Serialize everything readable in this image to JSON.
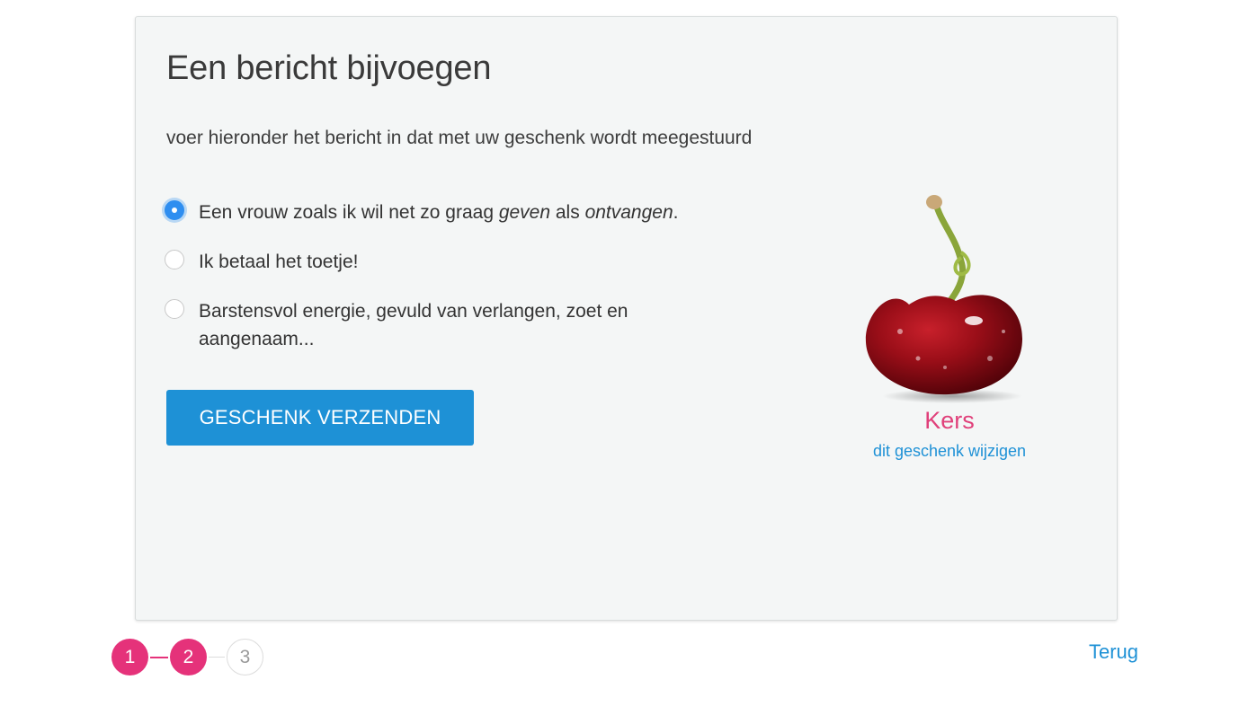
{
  "card": {
    "title": "Een bericht bijvoegen",
    "subtitle": "voer hieronder het bericht in dat met uw geschenk wordt meegestuurd"
  },
  "options": [
    {
      "selected": true,
      "parts": [
        "Een vrouw zoals ik wil net zo graag ",
        "geven",
        " als ",
        "ontvangen",
        "."
      ]
    },
    {
      "selected": false,
      "text": "Ik betaal het toetje!"
    },
    {
      "selected": false,
      "text": "Barstensvol energie, gevuld van verlangen, zoet en aangenaam..."
    }
  ],
  "send_button": "GESCHENK VERZENDEN",
  "gift": {
    "name": "Kers",
    "change_link": "dit geschenk wijzigen",
    "image_icon": "cherry-icon"
  },
  "steps": {
    "items": [
      "1",
      "2",
      "3"
    ],
    "current": 2
  },
  "back_link": "Terug",
  "colors": {
    "accent_blue": "#1e91d6",
    "accent_pink": "#e5327a",
    "radio_blue": "#2f8ef0"
  }
}
